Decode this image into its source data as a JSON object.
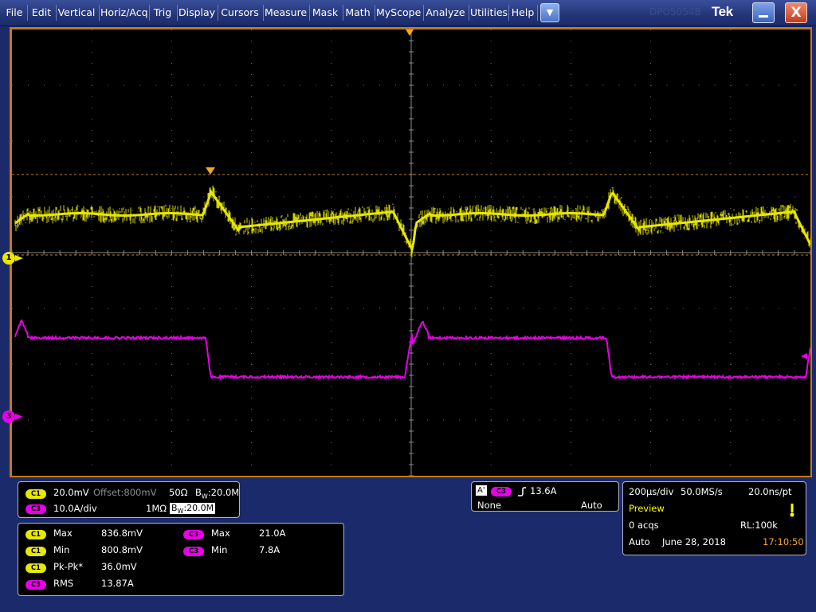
{
  "menubar": {
    "items": [
      "File",
      "Edit",
      "Vertical",
      "Horiz/Acq",
      "Trig",
      "Display",
      "Cursors",
      "Measure",
      "Mask",
      "Math",
      "MyScope",
      "Analyze",
      "Utilities",
      "Help"
    ],
    "dropdown_icon": "chevron-down-icon",
    "faint_text": "DPO5054B",
    "logo": "Tek",
    "minimize_icon": "minimize-icon",
    "close_icon": "close-icon",
    "close_glyph": "X"
  },
  "colors": {
    "ch1": "#e8e800",
    "ch3": "#e800e8",
    "frame": "#c07a1a",
    "trigger_marker": "#f5a623",
    "grid": "#6f6f6f"
  },
  "markers": {
    "ch1_label": "1",
    "ch3_label": "3"
  },
  "channels": {
    "c1": {
      "badge": "C1",
      "scale": "20.0mV",
      "offset": "Offset:800mV",
      "termination": "50Ω",
      "bw_prefix": "B",
      "bw_sub": "W",
      "bw": ":20.0M"
    },
    "c3": {
      "badge": "C3",
      "scale": "10.0A/div",
      "termination": "1MΩ",
      "bw_prefix": "B",
      "bw_sub": "W",
      "bw": ":20.0M"
    }
  },
  "measurements": [
    {
      "badge": "C1",
      "name": "Max",
      "value": "836.8mV"
    },
    {
      "badge": "C1",
      "name": "Min",
      "value": "800.8mV"
    },
    {
      "badge": "C1",
      "name": "Pk-Pk*",
      "value": "36.0mV"
    },
    {
      "badge": "C3",
      "name": "RMS",
      "value": "13.87A"
    },
    {
      "badge": "C3",
      "name": "Max",
      "value": "21.0A"
    },
    {
      "badge": "C3",
      "name": "Min",
      "value": "7.8A"
    }
  ],
  "trigger": {
    "type_badge": "A'",
    "source_badge": "C3",
    "slope_icon": "rising-edge-icon",
    "level": "13.6A",
    "coupling": "None",
    "mode": "Auto"
  },
  "acquisition": {
    "time_div": "200µs/div",
    "sample_rate": "50.0MS/s",
    "resolution": "20.0ns/pt",
    "state": "Preview",
    "acqs": "0 acqs",
    "record_length": "RL:100k",
    "mode": "Auto",
    "date": "June 28, 2018",
    "time": "17:10:50",
    "status_icon": "warning-icon"
  }
}
